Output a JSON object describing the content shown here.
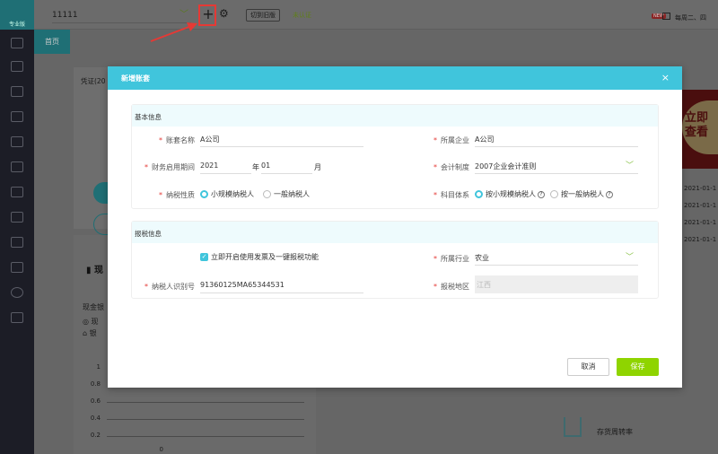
{
  "sidebar": {
    "logo_label": "专业版"
  },
  "topbar": {
    "account_name": "11111",
    "switch_label": "切到旧版",
    "verify_status": "未认证",
    "new_badge": "NEW",
    "notice": "每周二、四"
  },
  "tabs": [
    {
      "label": "首页"
    }
  ],
  "background": {
    "voucher_title": "凭证(20",
    "cash_title": "现",
    "cash_subtitle": "现金银",
    "legend_cash": "现",
    "legend_bank": "银",
    "y_ticks": [
      "1",
      "0.8",
      "0.6",
      "0.4",
      "0.2",
      "0"
    ],
    "banner": "立即查看",
    "dates": [
      "2021-01-1",
      "2021-01-1",
      "2021-01-1",
      "2021-01-1"
    ],
    "inventory": "存货周转率"
  },
  "modal": {
    "title": "新增账套",
    "close": "×",
    "basic": {
      "title": "基本信息",
      "account_name_label": "账套名称",
      "account_name": "A公司",
      "company_label": "所属企业",
      "company": "A公司",
      "period_label": "财务启用期间",
      "year": "2021",
      "year_unit": "年",
      "month": "01",
      "month_unit": "月",
      "accounting_label": "会计制度",
      "accounting": "2007企业会计准则",
      "tax_nature_label": "纳税性质",
      "tax_nature_options": [
        "小规模纳税人",
        "一般纳税人"
      ],
      "subject_label": "科目体系",
      "subject_options": [
        "按小规模纳税人",
        "按一般纳税人"
      ]
    },
    "tax": {
      "title": "报税信息",
      "enable_label": "立即开启使用发票及一键报税功能",
      "enable_checked": true,
      "industry_label": "所属行业",
      "industry": "农业",
      "taxpayer_id_label": "纳税人识别号",
      "taxpayer_id": "91360125MA65344531",
      "region_label": "报税地区",
      "region": "江西"
    },
    "cancel": "取消",
    "save": "保存"
  }
}
